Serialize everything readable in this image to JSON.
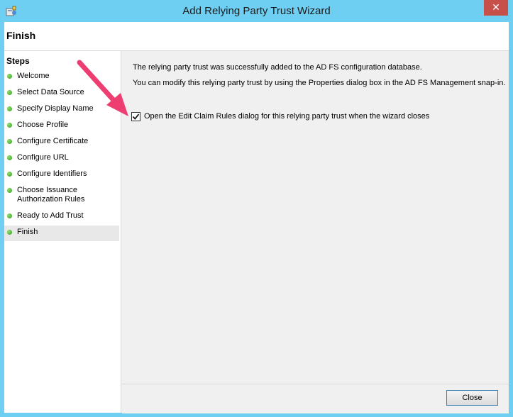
{
  "window": {
    "title": "Add Relying Party Trust Wizard",
    "close_glyph": "✕"
  },
  "header": {
    "title": "Finish"
  },
  "steps": {
    "heading": "Steps",
    "items": [
      {
        "label": "Welcome"
      },
      {
        "label": "Select Data Source"
      },
      {
        "label": "Specify Display Name"
      },
      {
        "label": "Choose Profile"
      },
      {
        "label": "Configure Certificate"
      },
      {
        "label": "Configure URL"
      },
      {
        "label": "Configure Identifiers"
      },
      {
        "label_line1": "Choose Issuance",
        "label_line2": "Authorization Rules"
      },
      {
        "label": "Ready to Add Trust"
      },
      {
        "label": "Finish"
      }
    ],
    "current": "Finish"
  },
  "content": {
    "message1": "The relying party trust was successfully added to the AD FS configuration database.",
    "message2": "You can modify this relying party trust by using the Properties dialog box in the AD FS Management snap-in.",
    "checkbox_label": "Open the Edit Claim Rules dialog for this relying party trust when the wizard closes",
    "checkbox_checked": true
  },
  "footer": {
    "close_label": "Close"
  },
  "colors": {
    "frame": "#6ecff2",
    "close_x": "#c7504a",
    "arrow": "#ee3e71",
    "step_dot": "#3aa82a"
  }
}
